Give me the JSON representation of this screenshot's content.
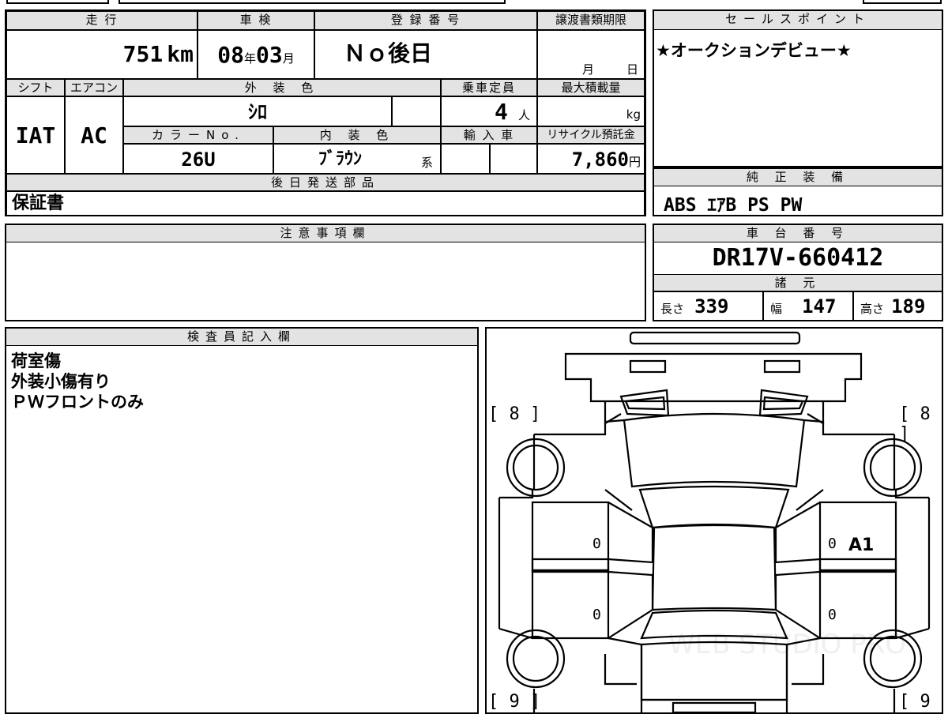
{
  "headers": {
    "mileage": "走 行",
    "shaken": "車 検",
    "registration": "登 録 番 号",
    "transfer_deadline": "譲渡書類期限",
    "sales_points": "セールスポイント",
    "shift": "シフト",
    "aircon": "エアコン",
    "exterior_color": "外 装 色",
    "capacity": "乗車定員",
    "max_load": "最大積載量",
    "color_no": "カラーNo.",
    "interior_color": "内 装 色",
    "import": "輸 入 車",
    "recycle": "リサイクル預託金",
    "later_parts": "後日発送部品",
    "standard_equipment": "純 正 装 備",
    "notes": "注意事項欄",
    "chassis_number": "車 台 番 号",
    "specs": "諸 元",
    "inspector": "検査員記入欄"
  },
  "values": {
    "mileage": "751",
    "mileage_unit": "km",
    "shaken_year": "08",
    "shaken_year_unit": "年",
    "shaken_month": "03",
    "shaken_month_unit": "月",
    "registration": "Ｎｏ後日",
    "transfer_month_unit": "月",
    "transfer_day_unit": "日",
    "sales_point": "★オークションデビュー★",
    "shift": "IAT",
    "aircon": "AC",
    "exterior_color": "ｼﾛ",
    "capacity": "4",
    "capacity_unit": "人",
    "max_load_unit": "kg",
    "color_no": "26U",
    "interior_color": "ﾌﾞﾗｳﾝ",
    "interior_suffix": "系",
    "recycle": "7,860",
    "recycle_unit": "円",
    "later_parts": "保証書",
    "standard_equipment": "ABS ｴｱB PS PW",
    "chassis_number": "DR17V-660412",
    "length_label": "長さ",
    "length": "339",
    "width_label": "幅",
    "width": "147",
    "height_label": "高さ",
    "height": "189"
  },
  "inspector_notes": [
    "荷室傷",
    "外装小傷有り",
    "ＰＷフロントのみ"
  ],
  "diagram": {
    "front_left_tire": "[ 8 ]",
    "front_right_tire": "[ 8 ]",
    "rear_left_tire": "[ 9 ]",
    "rear_right_tire": "[ 9 ]",
    "door_fl": "0",
    "door_fr": "0",
    "door_rl": "0",
    "door_rr": "0",
    "damage_fr": "A1",
    "watermark": "WEB STUDIO PRO"
  }
}
